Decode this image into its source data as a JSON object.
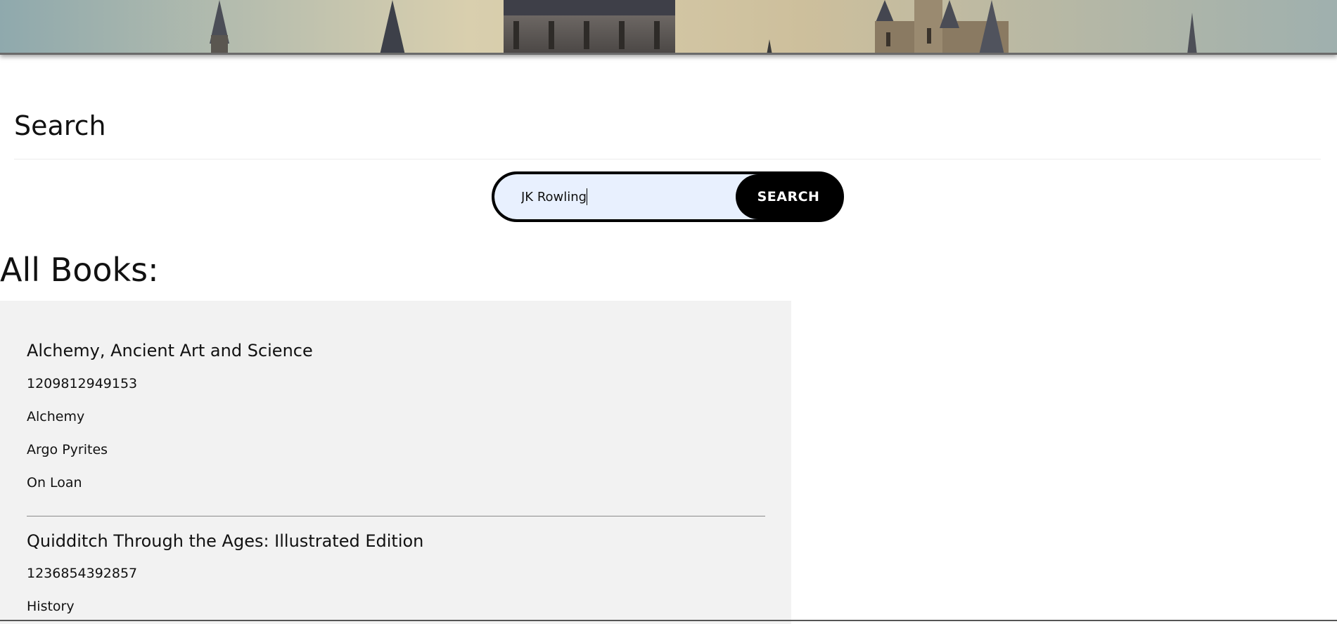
{
  "search": {
    "title": "Search",
    "input_value": "JK Rowling",
    "button_label": "SEARCH"
  },
  "books_section": {
    "title": "All Books:"
  },
  "books": [
    {
      "title": "Alchemy, Ancient Art and Science",
      "isbn": "1209812949153",
      "category": "Alchemy",
      "author": "Argo Pyrites",
      "status": "On Loan"
    },
    {
      "title": "Quidditch Through the Ages: Illustrated Edition",
      "isbn": "1236854392857",
      "category": "History"
    }
  ],
  "colors": {
    "input_background": "#e8f0fe",
    "button_background": "#000000",
    "panel_background": "#f2f2f2"
  }
}
